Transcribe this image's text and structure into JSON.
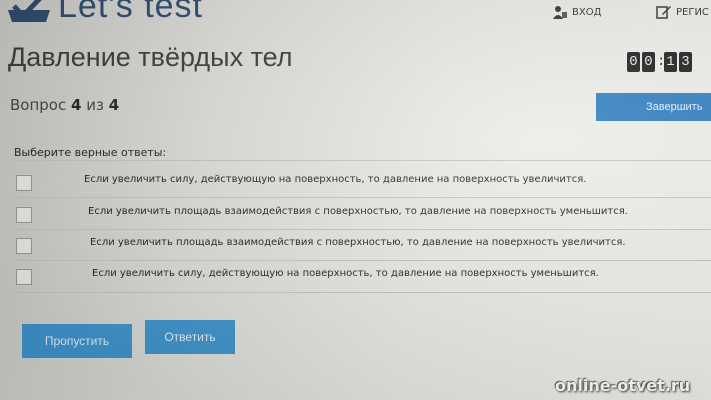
{
  "logo": {
    "text": "Let's test"
  },
  "header": {
    "login_label": "ВХОД",
    "register_label": "РЕГИС"
  },
  "page_title": "Давление твёрдых тел",
  "timer": {
    "digits": [
      "0",
      "0",
      "1",
      "3"
    ]
  },
  "question_counter": {
    "prefix": "Вопрос",
    "current": "4",
    "separator": "из",
    "total": "4"
  },
  "finish_button": {
    "label": "Завершить"
  },
  "instruction": "Выберите верные ответы:",
  "options": [
    {
      "text": "Если увеличить силу, действующую на поверхность, то давление на поверхность увеличится.",
      "checked": false
    },
    {
      "text": "Если увеличить площадь взаимодействия с поверхностью, то давление на поверхность уменьшится.",
      "checked": false
    },
    {
      "text": "Если увеличить площадь взаимодействия с поверхностью, то давление на поверхность увеличится.",
      "checked": false
    },
    {
      "text": "Если увеличить силу, действующую на поверхность, то давление на поверхность уменьшится.",
      "checked": false
    }
  ],
  "buttons": {
    "skip_label": "Пропустить",
    "answer_label": "Ответить"
  },
  "watermark": "online-otvet.ru",
  "colors": {
    "accent": "#3f95cf",
    "logo": "#2c4a6e",
    "finish": "#2f7ec1"
  }
}
